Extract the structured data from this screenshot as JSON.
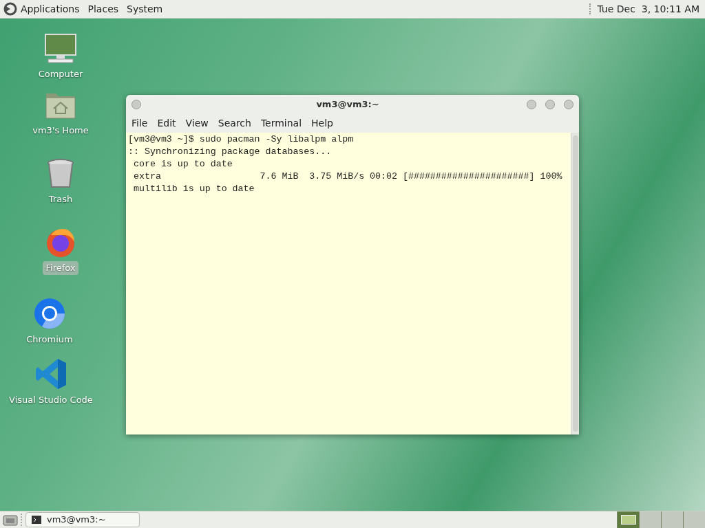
{
  "top_panel": {
    "menus": [
      "Applications",
      "Places",
      "System"
    ],
    "clock": "Tue Dec  3, 10:11 AM"
  },
  "desktop_icons": [
    {
      "kind": "computer",
      "label": "Computer",
      "selected": false
    },
    {
      "kind": "home",
      "label": "vm3's Home",
      "selected": false
    },
    {
      "kind": "trash",
      "label": "Trash",
      "selected": false
    },
    {
      "kind": "firefox",
      "label": "Firefox",
      "selected": true
    },
    {
      "kind": "chromium",
      "label": "Chromium",
      "selected": false
    },
    {
      "kind": "vscode",
      "label": "Visual Studio Code",
      "selected": false
    }
  ],
  "terminal": {
    "title": "vm3@vm3:~",
    "menus": [
      "File",
      "Edit",
      "View",
      "Search",
      "Terminal",
      "Help"
    ],
    "lines": [
      "[vm3@vm3 ~]$ sudo pacman -Sy libalpm alpm",
      ":: Synchronizing package databases...",
      " core is up to date",
      " extra                  7.6 MiB  3.75 MiB/s 00:02 [######################] 100%",
      " multilib is up to date"
    ]
  },
  "taskbar": {
    "tasks": [
      {
        "label": "vm3@vm3:~",
        "selected": true
      }
    ],
    "workspaces": [
      {
        "selected": true
      },
      {
        "selected": false
      },
      {
        "selected": false
      },
      {
        "selected": false
      }
    ]
  }
}
